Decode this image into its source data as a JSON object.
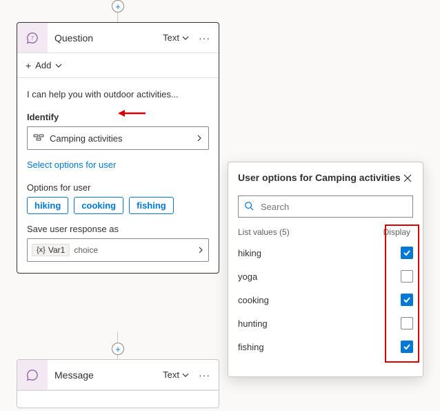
{
  "connector": {
    "add": "+"
  },
  "question_card": {
    "title": "Question",
    "type_label": "Text",
    "more": "···",
    "add_label": "Add",
    "statement": "I can help you with outdoor activities...",
    "identify_label": "Identify",
    "identify_value": "Camping activities",
    "select_link": "Select options for user",
    "options_label": "Options for user",
    "chips": [
      "hiking",
      "cooking",
      "fishing"
    ],
    "save_label": "Save user response as",
    "var_name": "Var1",
    "var_type": "choice"
  },
  "message_card": {
    "title": "Message",
    "type_label": "Text",
    "more": "···"
  },
  "popover": {
    "title": "User options for Camping activities",
    "search_placeholder": "Search",
    "list_header": "List values (5)",
    "display_header": "Display",
    "options": [
      {
        "label": "hiking",
        "checked": true
      },
      {
        "label": "yoga",
        "checked": false
      },
      {
        "label": "cooking",
        "checked": true
      },
      {
        "label": "hunting",
        "checked": false
      },
      {
        "label": "fishing",
        "checked": true
      }
    ]
  }
}
